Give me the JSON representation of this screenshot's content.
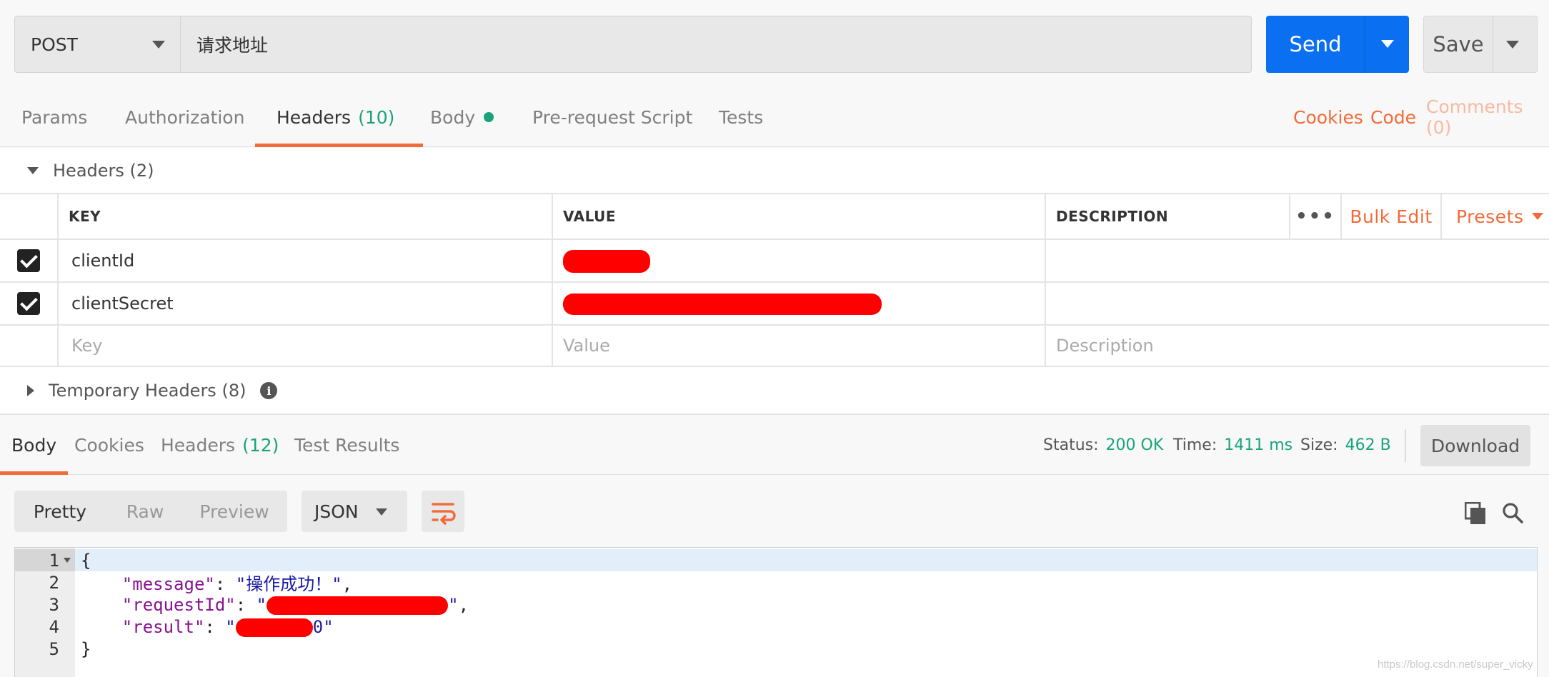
{
  "request": {
    "method": "POST",
    "url": "请求地址",
    "send_label": "Send",
    "save_label": "Save"
  },
  "tabs": {
    "params": "Params",
    "authorization": "Authorization",
    "headers": "Headers",
    "headers_count": "(10)",
    "body": "Body",
    "prerequest": "Pre-request Script",
    "tests": "Tests",
    "cookies": "Cookies",
    "code": "Code",
    "comments": "Comments (0)"
  },
  "headers_section": {
    "title": "Headers",
    "count": "(2)",
    "columns": {
      "key": "KEY",
      "value": "VALUE",
      "description": "DESCRIPTION"
    },
    "more": "•••",
    "bulk_edit": "Bulk Edit",
    "presets": "Presets",
    "rows": [
      {
        "key": "clientId",
        "value": "",
        "description": ""
      },
      {
        "key": "clientSecret",
        "value": "",
        "description": ""
      }
    ],
    "placeholder": {
      "key": "Key",
      "value": "Value",
      "description": "Description"
    },
    "temporary_title": "Temporary Headers",
    "temporary_count": "(8)",
    "info_glyph": "i"
  },
  "response": {
    "tabs": {
      "body": "Body",
      "cookies": "Cookies",
      "headers": "Headers",
      "headers_count": "(12)",
      "tests": "Test Results"
    },
    "status_label": "Status:",
    "status_value": "200 OK",
    "time_label": "Time:",
    "time_value": "1411 ms",
    "size_label": "Size:",
    "size_value": "462 B",
    "download": "Download",
    "view_modes": [
      "Pretty",
      "Raw",
      "Preview"
    ],
    "format": "JSON",
    "body_lines": [
      {
        "n": "1",
        "text": "{"
      },
      {
        "n": "2",
        "key": "\"message\"",
        "sep": ": ",
        "val": "\"操作成功！\"",
        "end": ","
      },
      {
        "n": "3",
        "key": "\"requestId\"",
        "sep": ": ",
        "val": "\"",
        "val2": "\"",
        "end": ","
      },
      {
        "n": "4",
        "key": "\"result\"",
        "sep": ": ",
        "val": "\"",
        "val2": "0\"",
        "end": ""
      },
      {
        "n": "5",
        "text": "}"
      }
    ]
  },
  "watermark": "https://blog.csdn.net/super_vicky",
  "colors": {
    "accent": "#f26b3a",
    "send": "#0b6ff1",
    "green": "#1aa37a",
    "redaction": "#ff0000"
  }
}
